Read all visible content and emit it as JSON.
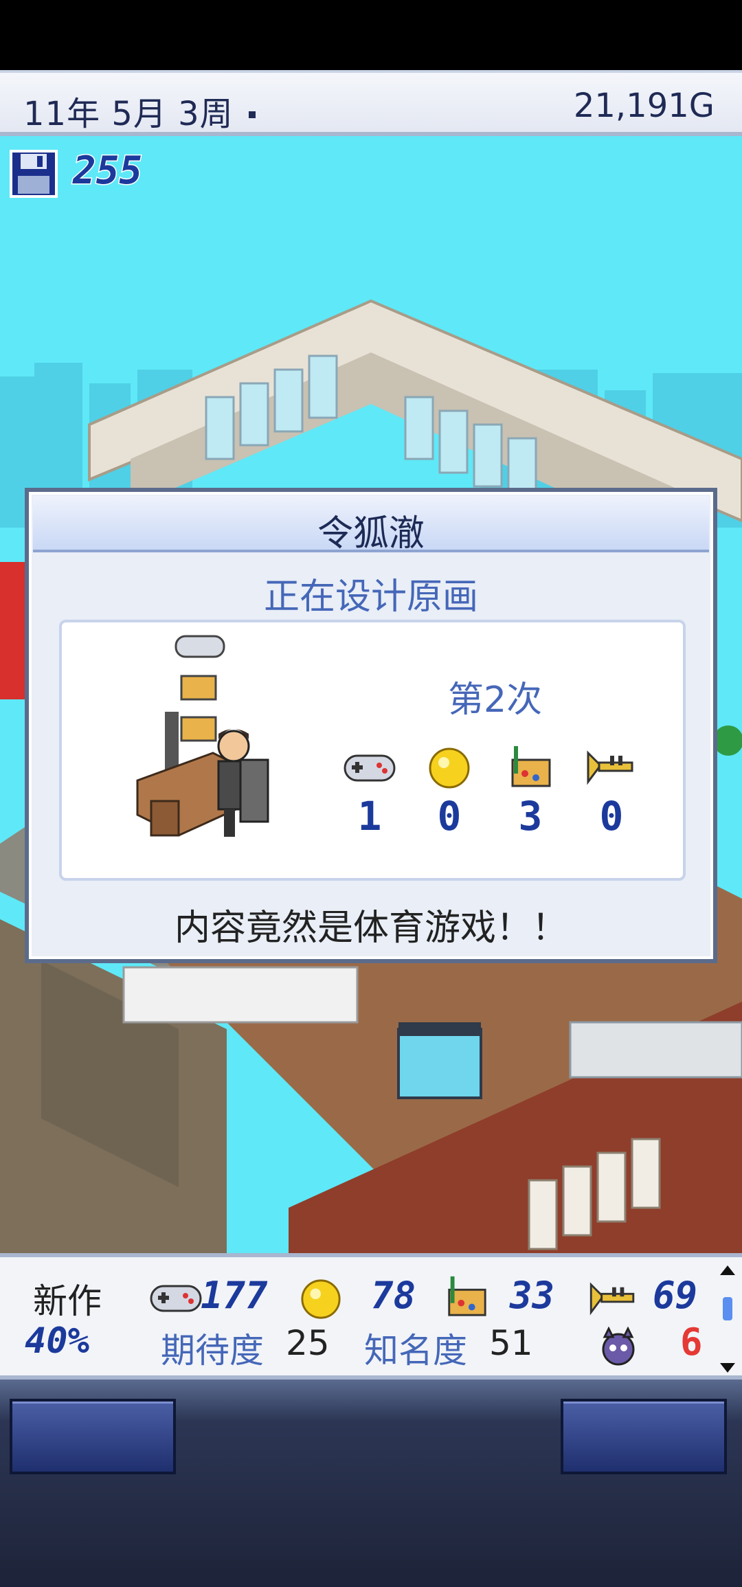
{
  "header": {
    "date": "11年 5月 3周",
    "money": "21,191G"
  },
  "save_count": "255",
  "dialog": {
    "name": "令狐澈",
    "status": "正在设计原画",
    "count": "第2次",
    "stats": [
      {
        "icon": "fun-controller-icon",
        "value": "1"
      },
      {
        "icon": "creativity-coin-icon",
        "value": "0"
      },
      {
        "icon": "graphics-art-icon",
        "value": "3"
      },
      {
        "icon": "sound-trumpet-icon",
        "value": "0"
      }
    ],
    "message": "内容竟然是体育游戏！！"
  },
  "project": {
    "label": "新作",
    "progress": "40%",
    "fun": "177",
    "creativity": "78",
    "graphics": "33",
    "sound": "69",
    "expectation_label": "期待度",
    "expectation": "25",
    "fame_label": "知名度",
    "fame": "51",
    "bugs": "6"
  },
  "colors": {
    "sky": "#5fe8f7",
    "accent": "#1c3a9c",
    "label_blue": "#4567b8",
    "bug_red": "#e53935"
  }
}
